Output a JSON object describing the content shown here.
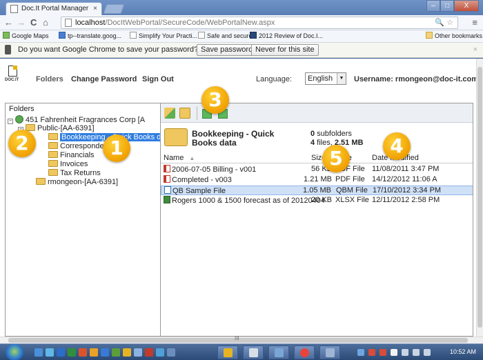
{
  "browser": {
    "tab_title": "Doc.It Portal Manager",
    "tab_close": "×",
    "window_buttons": [
      "–",
      "□",
      "X"
    ],
    "nav_back": "←",
    "nav_forward": "→",
    "nav_reload": "C",
    "nav_home": "⌂",
    "url_host": "localhost",
    "url_path": "/DocItWebPortal/SecureCode/WebPortalNew.aspx",
    "omnibox_right": "🔍 ☆",
    "menu": "≡",
    "bookmarks": [
      {
        "label": "Google Maps",
        "icon": "maps-icon"
      },
      {
        "label": "tp--translate.goog...",
        "icon": "translate-icon"
      },
      {
        "label": "Simplify Your Practi...",
        "icon": "page-icon"
      },
      {
        "label": "Safe and secure?",
        "icon": "page-icon"
      },
      {
        "label": "2012 Review of Doc.I...",
        "icon": "review-icon"
      }
    ],
    "other_bookmarks": "Other bookmarks",
    "infobar": {
      "text": "Do you want Google Chrome to save your password?",
      "save_label": "Save password",
      "never_label": "Never for this site",
      "close": "×"
    }
  },
  "app": {
    "logo_text": "DOC.IT",
    "nav": {
      "folders": "Folders",
      "change_password": "Change Password",
      "sign_out": "Sign Out"
    },
    "language_label": "Language:",
    "language_value": "English",
    "language_arrow": "▼",
    "username": "Username: rmongeon@doc-it.com"
  },
  "folders_panel": {
    "title": "Folders",
    "tree": [
      {
        "label": "451 Fahrenheit Fragrances Corp [A",
        "expander": "−"
      },
      {
        "label": "Public-[AA-6391]",
        "expander": "−"
      },
      {
        "label": "Bookkeeping - Quick Books d"
      },
      {
        "label": "Correspondence"
      },
      {
        "label": "Financials"
      },
      {
        "label": "Invoices"
      },
      {
        "label": "Tax Returns"
      },
      {
        "label": "rmongeon-[AA-6391]"
      }
    ]
  },
  "files_panel": {
    "current_folder": [
      "Bookkeeping - Quick",
      "Books data"
    ],
    "subfolders_count": "0",
    "subfolders_label": " subfolders",
    "files_count": "4",
    "files_label": " files, ",
    "files_size": "2.51 MB",
    "columns": {
      "name": "Name",
      "size": "Size",
      "type": "Type",
      "date": "Date Modified",
      "sort_indicator": "▲"
    },
    "files": [
      {
        "name": "2006-07-05 Billing - v001",
        "size": "56 KB",
        "type": "PDF File",
        "date": "11/08/2011 3:47 PM",
        "icon": "pdf-file-icon"
      },
      {
        "name": "Completed - v003",
        "size": "1.21 MB",
        "type": "PDF File",
        "date": "14/12/2012 11:06 A",
        "icon": "pdf-file-icon"
      },
      {
        "name": "QB Sample File",
        "size": "1.05 MB",
        "type": "QBM File",
        "date": "17/10/2012 3:34 PM",
        "icon": "qbm-file-icon"
      },
      {
        "name": "Rogers 1000 & 1500 forecast as of 20120404",
        "size": "20 KB",
        "type": "XLSX File",
        "date": "12/11/2012 2:58 PM",
        "icon": "xlsx-file-icon"
      }
    ]
  },
  "callouts": [
    "1",
    "2",
    "3",
    "4",
    "5"
  ],
  "taskbar": {
    "clock": "10:52 AM",
    "scroll_grip": "III"
  }
}
